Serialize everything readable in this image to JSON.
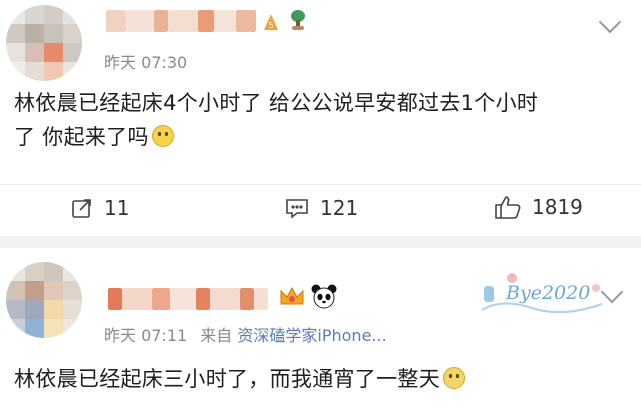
{
  "posts": [
    {
      "timestamp": "昨天 07:30",
      "source": "",
      "content_line1": "林依晨已经起床4个小时了 给公公说早安都过去1个小时",
      "content_line2": "了 你起来了吗",
      "actions": {
        "repost_count": "11",
        "comment_count": "121",
        "like_count": "1819"
      },
      "badge_level": "5"
    },
    {
      "timestamp": "昨天 07:11",
      "source_prefix": "来自",
      "source": "资深磕学家iPhone...",
      "content_line1": "林依晨已经起床三小时了，而我通宵了一整天",
      "fan_card_text": "Bye2020"
    }
  ],
  "colors": {
    "divider": "#ececec",
    "gap": "#f2f2f2",
    "source_link": "#5a7db8",
    "meta": "#8a8a8a"
  },
  "icons": [
    "repost-icon",
    "comment-icon",
    "like-icon",
    "expand-arrow-icon",
    "crown-icon",
    "panda-icon",
    "plant-icon",
    "emoji-smile-icon",
    "emoji-tired-icon"
  ]
}
